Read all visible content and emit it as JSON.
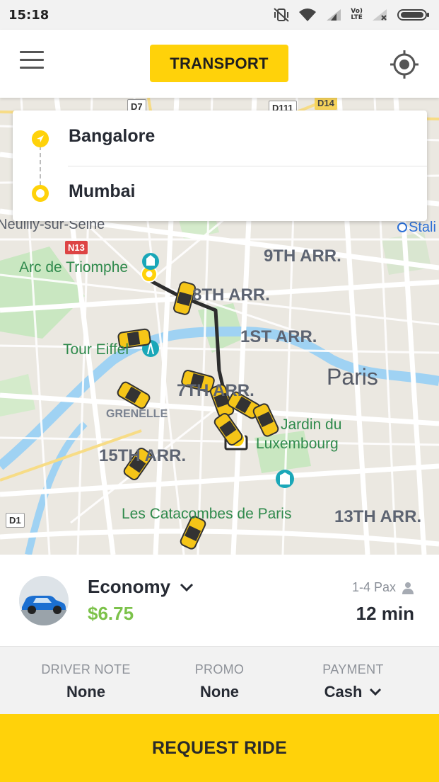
{
  "status_bar": {
    "time": "15:18",
    "network_badge_top": "Vo)",
    "network_badge_bottom": "LTE"
  },
  "header": {
    "title_button": "TRANSPORT",
    "menu_icon": "menu-icon",
    "locate_icon": "gps-target-icon"
  },
  "route": {
    "origin": "Bangalore",
    "destination": "Mumbai"
  },
  "map": {
    "labels": {
      "neuilly": "Neuilly-sur-Seine",
      "n13": "N13",
      "arc": "Arc de Triomphe",
      "arr9": "9TH ARR.",
      "arr8": "8TH ARR.",
      "arr1": "1ST ARR.",
      "tour": "Tour Eiffel",
      "paris": "Paris",
      "arr7": "7TH ARR.",
      "grenelle": "GRENELLE",
      "jardin1": "Jardin du",
      "jardin2": "Luxembourg",
      "arr15": "15TH ARR.",
      "catacombes": "Les Catacombes de Paris",
      "arr13": "13TH ARR.",
      "d1": "D1",
      "d7": "D7",
      "d111": "D111",
      "d14": "D14",
      "stalingrad": "Stali"
    },
    "colors": {
      "route": "#333333",
      "taxi": "#f5c518",
      "water": "#9fd2f3",
      "park": "#c9e7c1"
    }
  },
  "ride": {
    "type": "Economy",
    "price": "$6.75",
    "pax": "1-4 Pax",
    "eta": "12 min",
    "price_color": "#7cc24a"
  },
  "options": {
    "driver_note_label": "DRIVER NOTE",
    "driver_note_value": "None",
    "promo_label": "PROMO",
    "promo_value": "None",
    "payment_label": "PAYMENT",
    "payment_value": "Cash"
  },
  "request_button": "REQUEST RIDE",
  "accent_color": "#ffd20a"
}
